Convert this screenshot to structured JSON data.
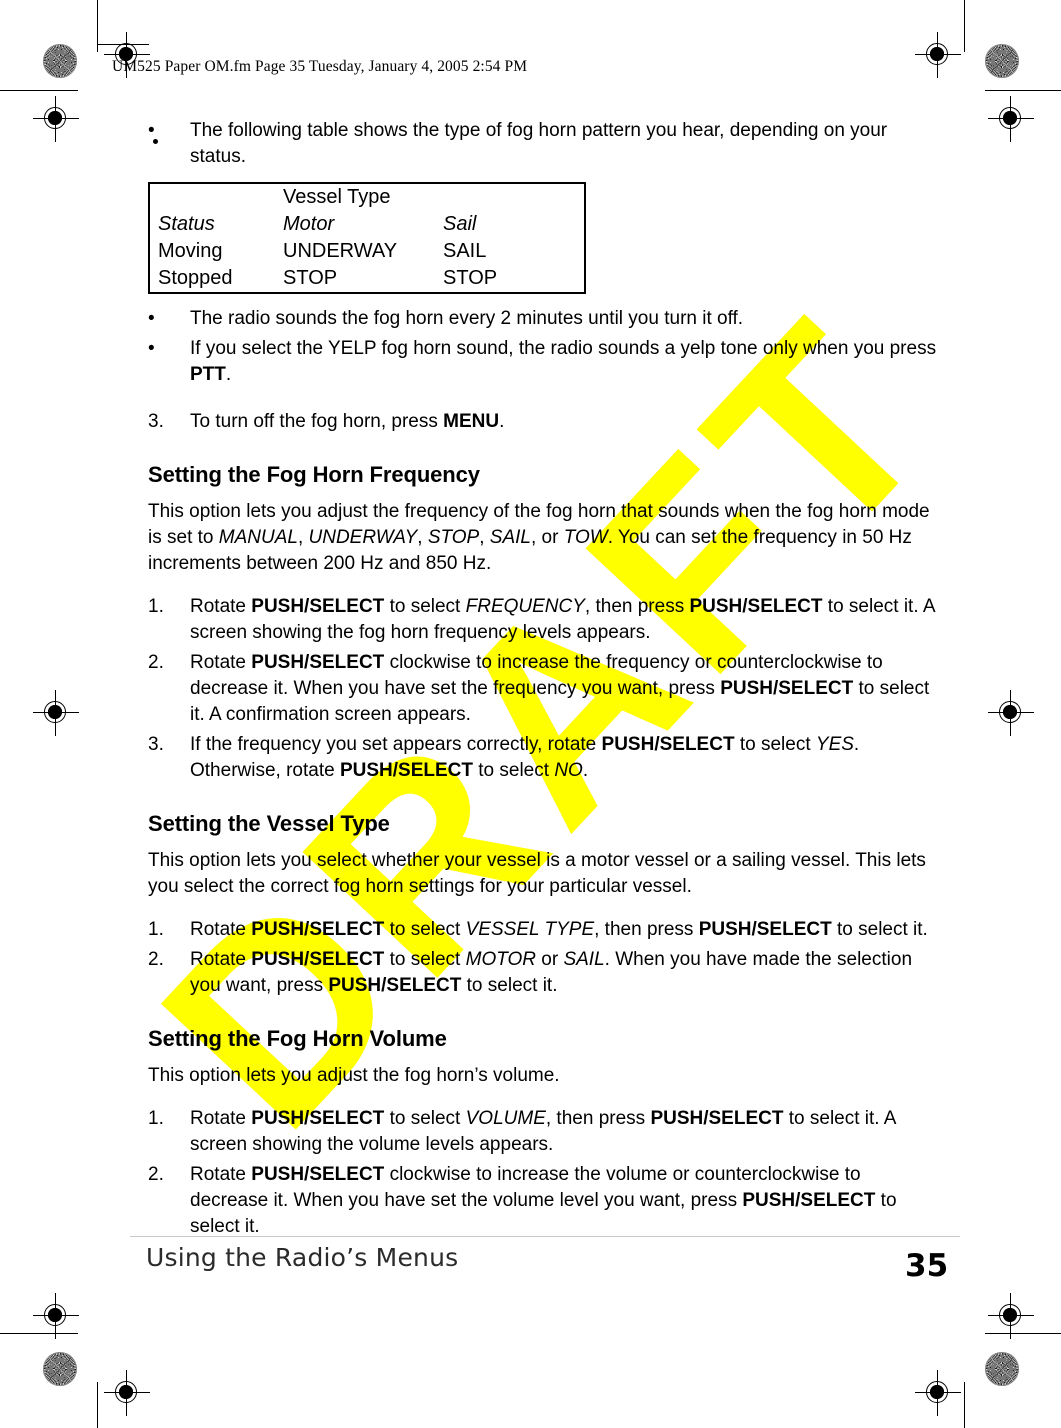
{
  "page": {
    "running_header": "UM525 Paper OM.fm  Page 35  Tuesday, January 4, 2005  2:54 PM",
    "watermark": "DRAFT",
    "watermark_color": "#ffff00"
  },
  "footer": {
    "title": "Using the Radio’s Menus",
    "page_number": "35"
  },
  "body": {
    "bullet_1": {
      "marker": "•",
      "text": "The following table shows the type of fog horn pattern you hear, depending on your status."
    },
    "bullet_2": {
      "marker": "•",
      "text": "The radio sounds the fog horn every 2 minutes until you turn it off."
    },
    "bullet_3": {
      "marker": "•",
      "text_before": "If you select the YELP fog horn sound, the radio sounds a yelp tone only when you press ",
      "bold_1": "PTT",
      "text_after": "."
    },
    "step_3_fog_horn": {
      "marker": "3.",
      "text_before": "To turn off the fog horn, press ",
      "bold_1": "MENU",
      "text_after": "."
    }
  },
  "table": {
    "group_header": "Vessel Type",
    "status_header": "Status",
    "col_headers": [
      "Motor",
      "Sail"
    ],
    "rows": [
      {
        "status": "Moving",
        "motor": "UNDERWAY",
        "sail": "SAIL"
      },
      {
        "status": "Stopped",
        "motor": "STOP",
        "sail": "STOP"
      }
    ]
  },
  "sections": [
    {
      "heading": "Setting the Fog Horn Frequency",
      "intro": {
        "p1": "This option lets you adjust the frequency of the fog horn that sounds when the fog horn mode is set to ",
        "i1": "MANUAL",
        "p2": ", ",
        "i2": "UNDERWAY",
        "p3": ", ",
        "i3": "STOP",
        "p4": ", ",
        "i4": "SAIL",
        "p5": ", or ",
        "i5": "TOW",
        "p6": ". You can set the frequency in 50 Hz increments between 200 Hz and 850 Hz."
      },
      "steps": [
        {
          "marker": "1.",
          "p1": "Rotate ",
          "b1": "PUSH/SELECT",
          "p2": " to select ",
          "i1": "FREQUENCY",
          "p3": ", then press ",
          "b2": "PUSH/SELECT",
          "p4": " to select it. A screen showing the fog horn frequency levels appears."
        },
        {
          "marker": "2.",
          "p1": "Rotate ",
          "b1": "PUSH/SELECT",
          "p2": " clockwise to increase the frequency or counterclockwise to decrease it. When you have set the frequency you want, press ",
          "b2": "PUSH/SELECT",
          "p3": " to select it. A confirmation screen appears."
        },
        {
          "marker": "3.",
          "p1": "If the frequency you set appears correctly, rotate ",
          "b1": "PUSH/SELECT",
          "p2": " to select ",
          "i1": "YES",
          "p3": ". Otherwise, rotate ",
          "b2": "PUSH/SELECT",
          "p4": " to select ",
          "i2": "NO",
          "p5": "."
        }
      ]
    },
    {
      "heading": "Setting the Vessel Type",
      "intro": {
        "p1": "This option lets you select whether your vessel is a motor vessel or a sailing vessel. This lets you select the correct fog horn settings for your particular vessel."
      },
      "steps": [
        {
          "marker": "1.",
          "p1": "Rotate ",
          "b1": "PUSH/SELECT",
          "p2": " to select ",
          "i1": "VESSEL TYPE",
          "p3": ", then press ",
          "b2": "PUSH/SELECT",
          "p4": " to select it."
        },
        {
          "marker": "2.",
          "p1": "Rotate ",
          "b1": "PUSH/SELECT",
          "p2": " to select ",
          "i1": "MOTOR",
          "p3": " or ",
          "i2": "SAIL",
          "p4": ". When you have made the selection you want, press ",
          "b2": "PUSH/SELECT",
          "p5": " to select it."
        }
      ]
    },
    {
      "heading": "Setting the Fog Horn Volume",
      "intro": {
        "p1": "This option lets you adjust the fog horn’s volume."
      },
      "steps": [
        {
          "marker": "1.",
          "p1": "Rotate ",
          "b1": "PUSH/SELECT",
          "p2": " to select ",
          "i1": "VOLUME",
          "p3": ", then press ",
          "b2": "PUSH/SELECT",
          "p4": " to select it. A screen showing the volume levels appears."
        },
        {
          "marker": "2.",
          "p1": "Rotate ",
          "b1": "PUSH/SELECT",
          "p2": " clockwise to increase the volume or counterclockwise to decrease it. When you have set the volume level you want, press ",
          "b2": "PUSH/SELECT",
          "p3": " to select it."
        }
      ]
    }
  ]
}
